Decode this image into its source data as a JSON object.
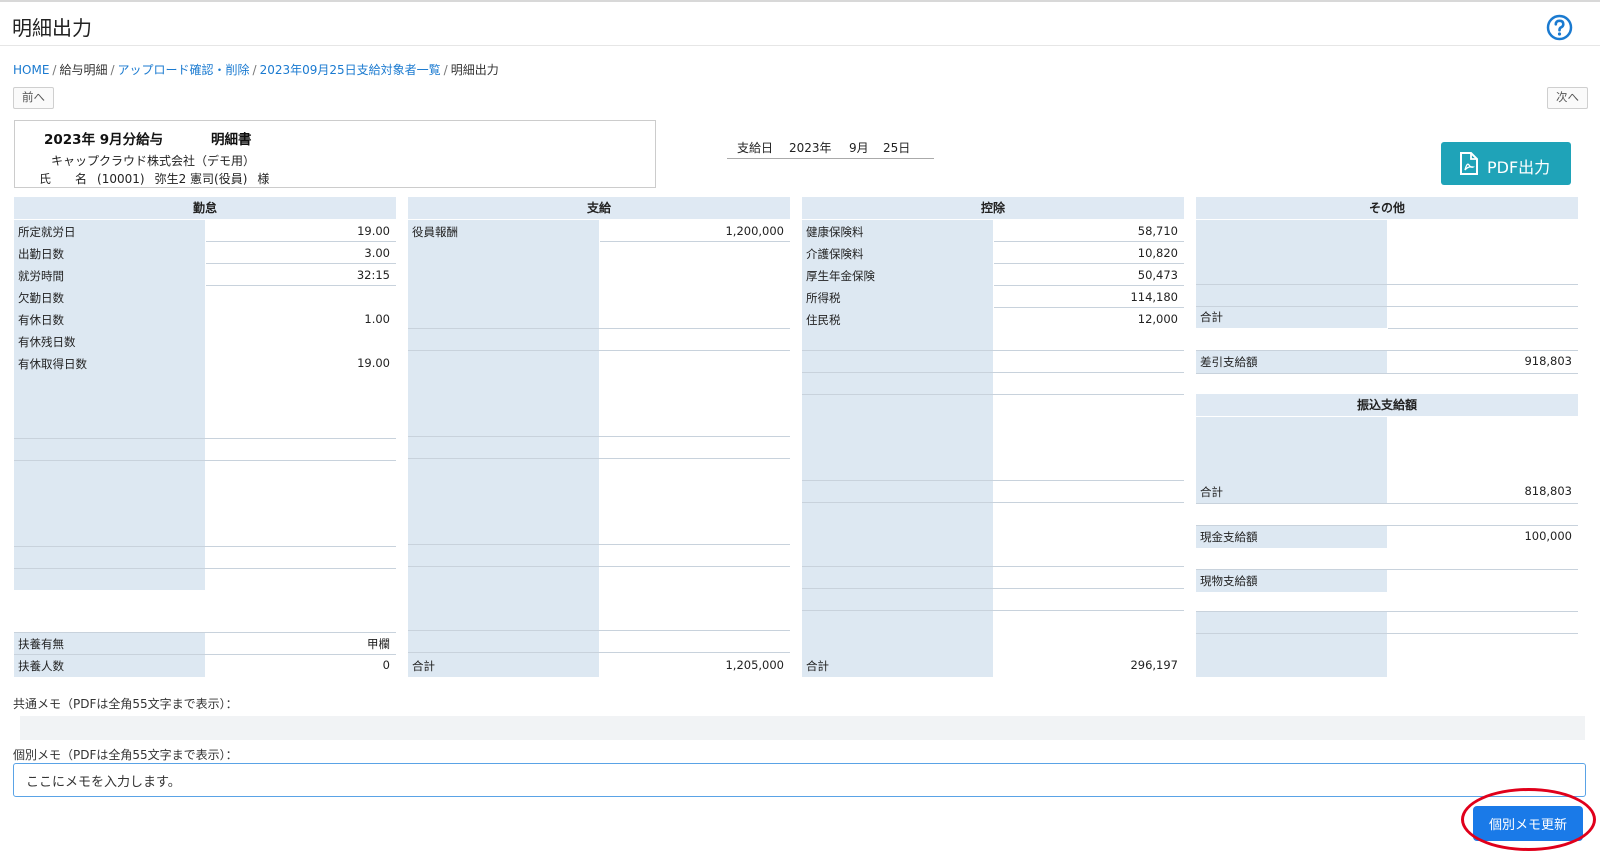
{
  "page": {
    "title": "明細出力"
  },
  "header": {
    "help_icon": "question-circle-icon",
    "accent": "#1a7ad0"
  },
  "breadcrumb": {
    "home": "HOME",
    "payslip": "給与明細",
    "upload": "アップロード確認・削除",
    "list": "2023年09月25日支給対象者一覧",
    "current": "明細出力"
  },
  "nav": {
    "prev": "前へ",
    "next": "次へ"
  },
  "slip": {
    "title": "2023年 9月分給与",
    "doc_name": "明細書",
    "company": "キャップクラウド株式会社（デモ用）",
    "name_label": "氏　　名",
    "employee_code": "(10001)",
    "employee_name": "弥生2 憲司(役員)",
    "honorific": "様"
  },
  "paydate": {
    "label": "支給日",
    "year": "2023年",
    "month": "9月",
    "day": "25日"
  },
  "pdf_button": {
    "label": "PDF出力",
    "icon": "pdf-file-icon",
    "color": "#1fa3b8"
  },
  "sections": {
    "attendance": {
      "title": "勤怠",
      "rows": [
        {
          "label": "所定就労日",
          "value": "19.00"
        },
        {
          "label": "出勤日数",
          "value": "3.00"
        },
        {
          "label": "就労時間",
          "value": "32:15"
        },
        {
          "label": "欠勤日数",
          "value": ""
        },
        {
          "label": "有休日数",
          "value": "1.00"
        },
        {
          "label": "有休残日数",
          "value": ""
        },
        {
          "label": "有休取得日数",
          "value": "19.00"
        }
      ],
      "bottom_rows": [
        {
          "label": "扶養有無",
          "value": "甲欄"
        },
        {
          "label": "扶養人数",
          "value": "0"
        }
      ]
    },
    "payment": {
      "title": "支給",
      "rows": [
        {
          "label": "役員報酬",
          "value": "1,200,000"
        }
      ],
      "total": {
        "label": "合計",
        "value": "1,205,000"
      }
    },
    "deduction": {
      "title": "控除",
      "rows": [
        {
          "label": "健康保険料",
          "value": "58,710"
        },
        {
          "label": "介護保険料",
          "value": "10,820"
        },
        {
          "label": "厚生年金保険",
          "value": "50,473"
        },
        {
          "label": "所得税",
          "value": "114,180"
        },
        {
          "label": "住民税",
          "value": "12,000"
        }
      ],
      "total": {
        "label": "合計",
        "value": "296,197"
      }
    },
    "other": {
      "title": "その他",
      "rows": [
        {
          "label": "合計",
          "value": ""
        },
        {
          "label": "差引支給額",
          "value": "918,803"
        }
      ],
      "transfer_title": "振込支給額",
      "transfer_rows": [
        {
          "label": "合計",
          "value": "818,803"
        },
        {
          "label": "現金支給額",
          "value": "100,000"
        },
        {
          "label": "現物支給額",
          "value": ""
        }
      ]
    }
  },
  "memo": {
    "common_label": "共通メモ（PDFは全角55文字まで表示）：",
    "common_value": "",
    "individual_label": "個別メモ（PDFは全角55文字まで表示）：",
    "individual_value": "ここにメモを入力します。",
    "update_button": "個別メモ更新",
    "highlight_color": "#e0001b"
  }
}
